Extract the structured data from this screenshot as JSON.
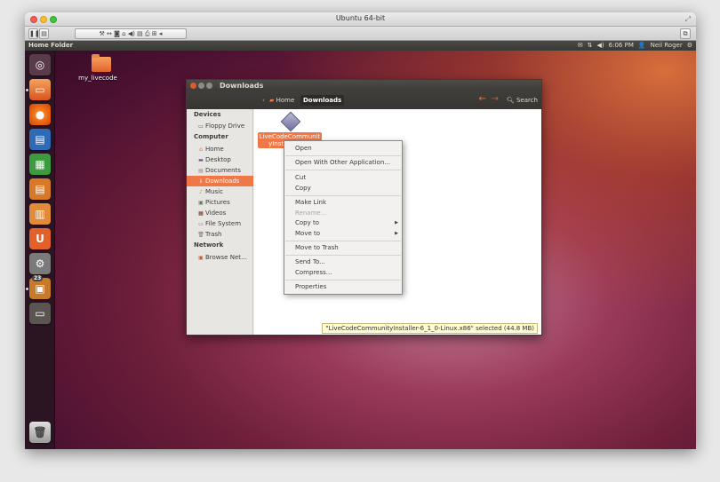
{
  "vm": {
    "title": "Ubuntu 64-bit"
  },
  "panel": {
    "title": "Home Folder",
    "time": "6:06 PM",
    "user": "Neil Roger"
  },
  "desktop": {
    "folder_label": "my_livecode"
  },
  "launcher": {
    "badge": "23"
  },
  "nautilus": {
    "title": "Downloads",
    "breadcrumbs": [
      "Home",
      "Downloads"
    ],
    "search_label": "Search",
    "sidebar": {
      "devices_heading": "Devices",
      "devices": [
        "Floppy Drive"
      ],
      "computer_heading": "Computer",
      "computer": [
        "Home",
        "Desktop",
        "Documents",
        "Downloads",
        "Music",
        "Pictures",
        "Videos",
        "File System",
        "Trash"
      ],
      "network_heading": "Network",
      "network": [
        "Browse Net…"
      ]
    },
    "file_label": "LiveCodeCommunit yInsta… Lin…",
    "status": "\"LiveCodeCommunityInstaller-6_1_0-Linux.x86\" selected (44.8 MB)"
  },
  "menu": {
    "open": "Open",
    "open_with": "Open With Other Application...",
    "cut": "Cut",
    "copy": "Copy",
    "make_link": "Make Link",
    "rename": "Rename...",
    "copy_to": "Copy to",
    "move_to": "Move to",
    "move_to_trash": "Move to Trash",
    "send_to": "Send To...",
    "compress": "Compress...",
    "properties": "Properties"
  },
  "colors": {
    "accent": "#f07746",
    "panel": "#3c3b37"
  }
}
